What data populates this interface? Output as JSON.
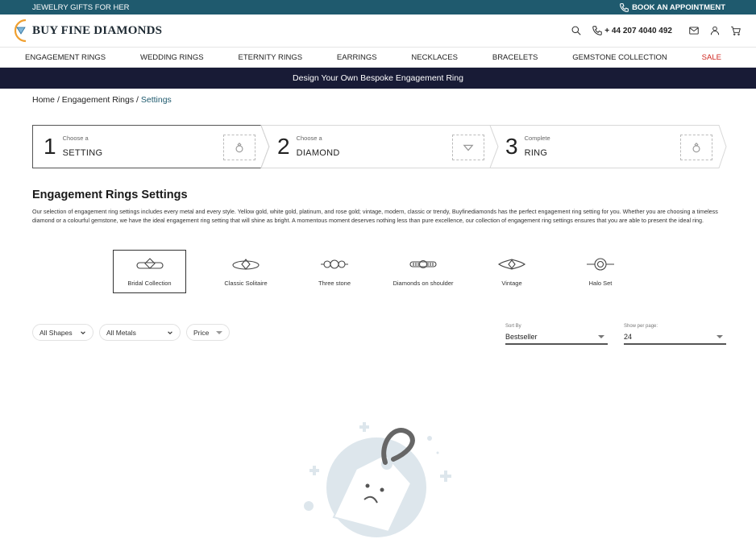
{
  "topbar": {
    "promo": "JEWELRY GIFTS FOR HER",
    "appointment": "BOOK AN APPOINTMENT"
  },
  "header": {
    "logo": "BUY FINE DIAMONDS",
    "phone": "+ 44 207 4040 492"
  },
  "nav": [
    "ENGAGEMENT RINGS",
    "WEDDING RINGS",
    "ETERNITY RINGS",
    "EARRINGS",
    "NECKLACES",
    "BRACELETS",
    "GEMSTONE COLLECTION",
    "SALE"
  ],
  "banner": "Design Your Own Bespoke Engagement Ring",
  "breadcrumb": {
    "home": "Home",
    "sep": "/",
    "parent": "Engagement Rings",
    "current": "Settings"
  },
  "steps": [
    {
      "num": "1",
      "small": "Choose a",
      "label": "SETTING",
      "icon": "ring-icon"
    },
    {
      "num": "2",
      "small": "Choose a",
      "label": "DIAMOND",
      "icon": "diamond-icon"
    },
    {
      "num": "3",
      "small": "Complete",
      "label": "RING",
      "icon": "ring-icon"
    }
  ],
  "page": {
    "title": "Engagement Rings Settings",
    "description": "Our selection of engagement ring settings includes every metal and every style. Yellow gold, white gold, platinum, and rose gold; vintage, modern, classic or trendy, Buyfinediamonds has the perfect engagement ring setting for you. Whether you are choosing a timeless diamond or a colourful gemstone, we have the ideal engagement ring setting that will shine as bright. A momentous moment deserves nothing less than pure excellence, our collection of engagement ring settings ensures that you are able to present the ideal ring."
  },
  "categories": [
    "Bridal Collection",
    "Classic Solitaire",
    "Three stone",
    "Diamonds on shoulder",
    "Vintage",
    "Halo Set"
  ],
  "filters": {
    "shapes": "All Shapes",
    "metals": "All Metals",
    "price": "Price"
  },
  "sort": {
    "label": "Sort By",
    "value": "Bestseller"
  },
  "perpage": {
    "label": "Show per page:",
    "value": "24"
  },
  "colors": {
    "topbar": "#1f5a6e",
    "banner": "#181b36",
    "sale": "#d0261f",
    "accent": "#f0a030"
  }
}
